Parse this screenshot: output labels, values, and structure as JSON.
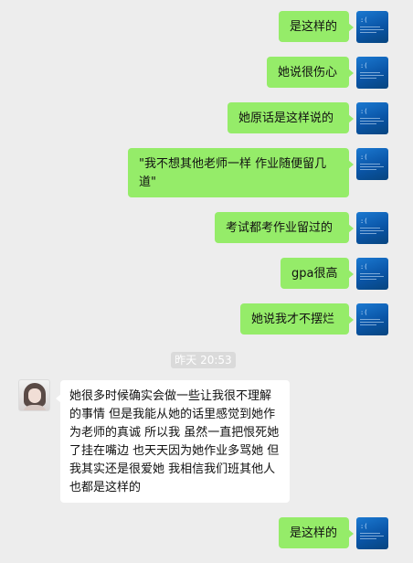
{
  "messages": [
    {
      "side": "me",
      "text": "是这样的"
    },
    {
      "side": "me",
      "text": "她说很伤心"
    },
    {
      "side": "me",
      "text": "她原话是这样说的"
    },
    {
      "side": "me",
      "text": "\"我不想其他老师一样 作业随便留几道\""
    },
    {
      "side": "me",
      "text": "考试都考作业留过的"
    },
    {
      "side": "me",
      "text": "gpa很高"
    },
    {
      "side": "me",
      "text": "她说我才不摆烂"
    },
    {
      "side": "her",
      "text": "她很多时候确实会做一些让我很不理解的事情 但是我能从她的话里感觉到她作为老师的真诚 所以我 虽然一直把恨死她了挂在嘴边 也天天因为她作业多骂她 但我其实还是很爱她 我相信我们班其他人也都是这样的"
    },
    {
      "side": "me",
      "text": "是这样的"
    }
  ],
  "timestamp": "昨天 20:53",
  "colors": {
    "background": "#ededed",
    "outgoing_bubble": "#95ec69",
    "incoming_bubble": "#ffffff",
    "timestamp_bg": "#dadada"
  },
  "icons": {
    "my_avatar": "blue-screen-avatar-icon",
    "her_avatar": "girl-photo-avatar"
  }
}
